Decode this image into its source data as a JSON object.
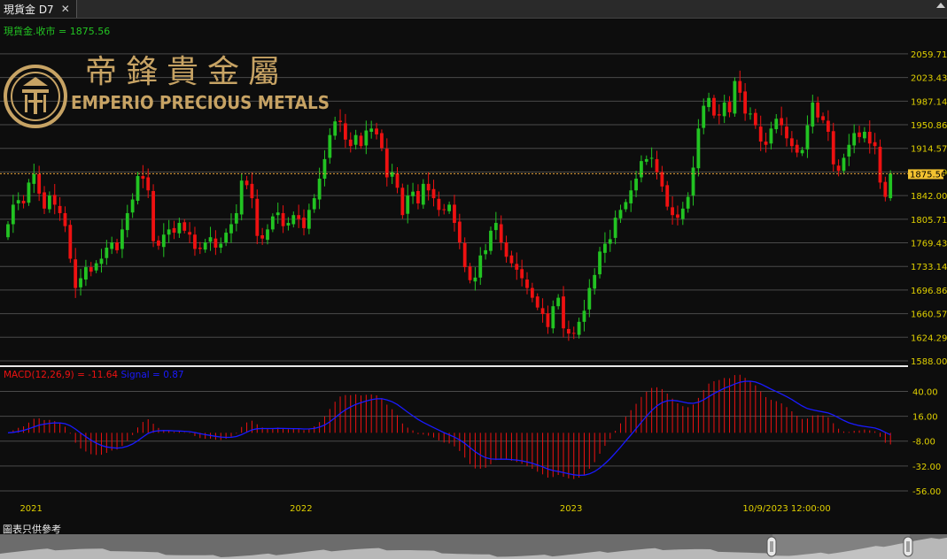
{
  "tab": {
    "title": "現貨金 D7",
    "close": "✕"
  },
  "logo": {
    "cjk": "帝鋒貴金屬",
    "latin": "EMPERIO PRECIOUS METALS"
  },
  "disclaimer": "圖表只供參考",
  "colors": {
    "up": "#22c322",
    "down": "#ee1111",
    "macd": "#ee1111",
    "signal": "#1a1aff",
    "price_line": "#e8a23a",
    "axis_text": "#e0d000"
  },
  "chart_data": [
    {
      "type": "candlestick",
      "legend": "現貨金.收市 = 1875.56",
      "current_price": 1875.56,
      "current_price_label": "1875.56",
      "ylim": [
        1588.0,
        2080.0
      ],
      "y_ticks": [
        "2059.71",
        "2023.43",
        "1987.14",
        "1950.86",
        "1914.57",
        "1878.29",
        "1842.00",
        "1805.71",
        "1769.43",
        "1733.14",
        "1696.86",
        "1660.57",
        "1624.29",
        "1588.00"
      ],
      "x_labels": [
        {
          "label": "2021",
          "index": 4
        },
        {
          "label": "2022",
          "index": 56
        },
        {
          "label": "2023",
          "index": 108
        },
        {
          "label": "10/9/2023 12:00:00",
          "index": 147
        }
      ],
      "closes": [
        1798,
        1828,
        1835,
        1830,
        1862,
        1875,
        1845,
        1822,
        1842,
        1828,
        1815,
        1795,
        1745,
        1700,
        1715,
        1732,
        1725,
        1738,
        1745,
        1762,
        1770,
        1758,
        1790,
        1815,
        1836,
        1872,
        1868,
        1850,
        1772,
        1765,
        1782,
        1790,
        1785,
        1800,
        1788,
        1782,
        1760,
        1760,
        1770,
        1778,
        1762,
        1768,
        1785,
        1798,
        1815,
        1865,
        1858,
        1838,
        1780,
        1776,
        1790,
        1810,
        1816,
        1795,
        1800,
        1812,
        1806,
        1792,
        1820,
        1838,
        1868,
        1898,
        1935,
        1956,
        1955,
        1928,
        1918,
        1935,
        1918,
        1942,
        1945,
        1936,
        1915,
        1870,
        1878,
        1854,
        1812,
        1842,
        1848,
        1830,
        1860,
        1850,
        1838,
        1820,
        1820,
        1828,
        1800,
        1770,
        1732,
        1712,
        1716,
        1750,
        1758,
        1788,
        1800,
        1770,
        1748,
        1738,
        1728,
        1715,
        1700,
        1685,
        1670,
        1660,
        1640,
        1672,
        1685,
        1638,
        1630,
        1630,
        1648,
        1665,
        1700,
        1720,
        1756,
        1768,
        1775,
        1808,
        1820,
        1832,
        1850,
        1868,
        1895,
        1898,
        1900,
        1878,
        1856,
        1825,
        1812,
        1808,
        1822,
        1840,
        1885,
        1945,
        1980,
        1992,
        1965,
        1965,
        1985,
        1970,
        2018,
        2000,
        1968,
        1968,
        1950,
        1925,
        1920,
        1945,
        1960,
        1950,
        1930,
        1918,
        1908,
        1912,
        1950,
        1985,
        1962,
        1958,
        1940,
        1890,
        1880,
        1900,
        1920,
        1938,
        1932,
        1940,
        1922,
        1918,
        1862,
        1840,
        1876
      ],
      "macd": {
        "name": "MACD(12,26,9)",
        "macd_value": "-11.64",
        "signal_name": "Signal",
        "signal_value": "0.87",
        "ylim": [
          -62,
          60
        ],
        "y_ticks": [
          "40.00",
          "16.00",
          "-8.00",
          "-32.00",
          "-56.00"
        ]
      }
    }
  ]
}
